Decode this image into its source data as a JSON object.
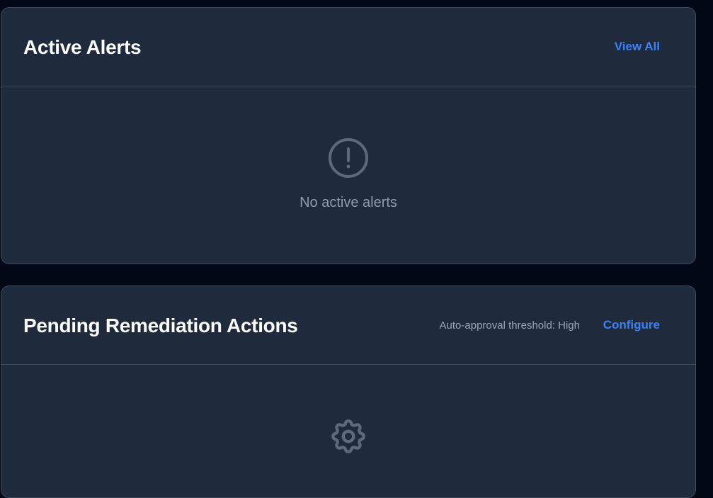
{
  "alerts_panel": {
    "title": "Active Alerts",
    "view_all_label": "View All",
    "empty_icon": "alert-circle-icon",
    "empty_message": "No active alerts"
  },
  "remediation_panel": {
    "title": "Pending Remediation Actions",
    "threshold_text": "Auto-approval threshold: High",
    "configure_label": "Configure",
    "empty_icon": "gear-icon"
  },
  "colors": {
    "background": "#030816",
    "card": "#1f2a3c",
    "border": "#3d4a5e",
    "accent": "#3b82f6",
    "muted_text": "#8e9bad",
    "icon": "#5d6a7e"
  }
}
